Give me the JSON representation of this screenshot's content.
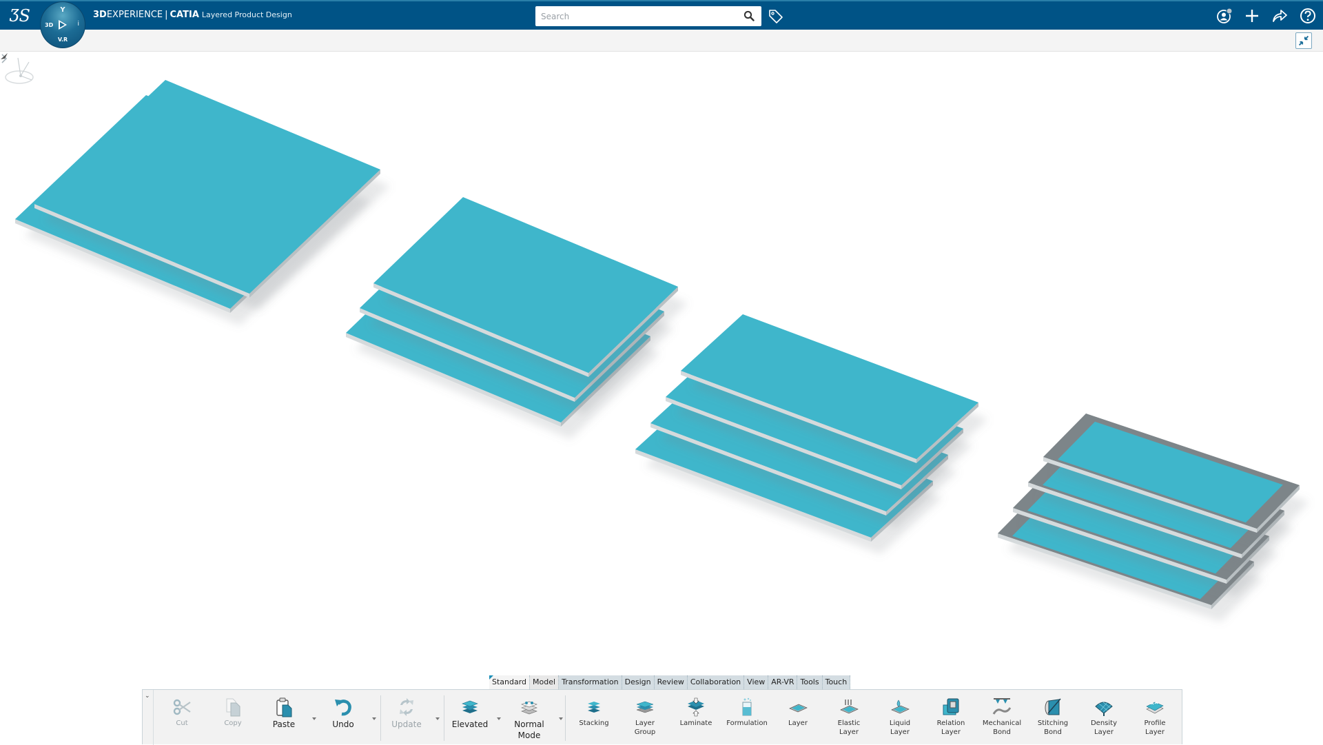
{
  "header": {
    "brand_prefix": "3D",
    "brand_rest": "EXPERIENCE",
    "separator": "|",
    "product": "CATIA",
    "app_name": "Layered Product Design",
    "compass": {
      "top": "Y",
      "left": "3D",
      "right": "i",
      "bottom": "V.R"
    },
    "logo": "ƷS"
  },
  "search": {
    "placeholder": "Search",
    "value": ""
  },
  "header_icons": [
    "tag-icon",
    "user-profile-icon",
    "add-icon",
    "share-icon",
    "help-icon"
  ],
  "viewbar": {
    "fullscreen_icon": "exit-fullscreen-icon"
  },
  "viewport": {
    "model_color": "#3fb6cb",
    "edge_color": "#d5dadc",
    "frame_color": "#7d8589",
    "stacks": [
      {
        "name": "stack-2-layers",
        "layers": 2
      },
      {
        "name": "stack-3-layers",
        "layers": 3
      },
      {
        "name": "stack-4-layers",
        "layers": 4
      },
      {
        "name": "stack-4-layers-framed",
        "layers": 4
      }
    ]
  },
  "action_bar": {
    "tabs": [
      {
        "label": "Standard",
        "active": true
      },
      {
        "label": "Model"
      },
      {
        "label": "Transformation"
      },
      {
        "label": "Design"
      },
      {
        "label": "Review"
      },
      {
        "label": "Collaboration"
      },
      {
        "label": "View"
      },
      {
        "label": "AR-VR"
      },
      {
        "label": "Tools"
      },
      {
        "label": "Touch"
      }
    ],
    "commands": {
      "cut": {
        "label": "Cut",
        "enabled": false
      },
      "copy": {
        "label": "Copy",
        "enabled": false
      },
      "paste": {
        "label": "Paste"
      },
      "undo": {
        "label": "Undo"
      },
      "update": {
        "label": "Update",
        "enabled": false
      },
      "elevated": {
        "label": "Elevated"
      },
      "normal_mode": {
        "label": "Normal Mode",
        "line1": "Normal",
        "line2": "Mode"
      },
      "stacking": {
        "label": "Stacking"
      },
      "layer_group": {
        "line1": "Layer",
        "line2": "Group"
      },
      "laminate": {
        "label": "Laminate"
      },
      "formulation": {
        "label": "Formulation"
      },
      "layer": {
        "label": "Layer"
      },
      "elastic_layer": {
        "line1": "Elastic",
        "line2": "Layer"
      },
      "liquid_layer": {
        "line1": "Liquid",
        "line2": "Layer"
      },
      "relation_layer": {
        "line1": "Relation",
        "line2": "Layer"
      },
      "mechanical_bond": {
        "line1": "Mechanical",
        "line2": "Bond"
      },
      "stitching_bond": {
        "line1": "Stitching",
        "line2": "Bond"
      },
      "density_layer": {
        "line1": "Density",
        "line2": "Layer"
      },
      "profile_layer": {
        "line1": "Profile",
        "line2": "Layer"
      }
    }
  },
  "colors": {
    "header_bg": "#005386",
    "accent": "#1d8fb8",
    "toolbar_bg": "#f2f2f2"
  }
}
